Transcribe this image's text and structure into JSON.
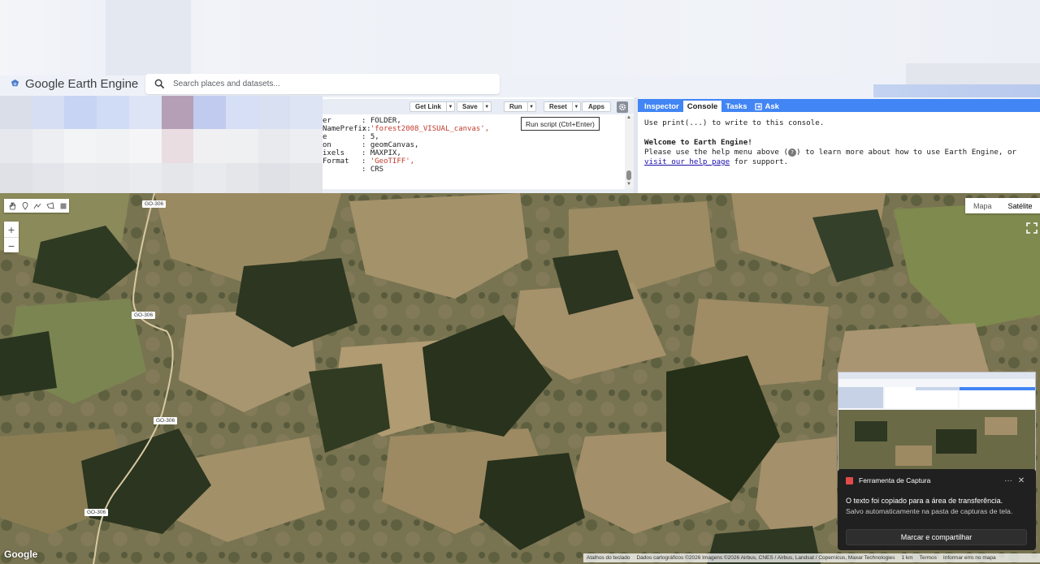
{
  "header": {
    "logo_text": "Google Earth Engine",
    "search_placeholder": "Search places and datasets..."
  },
  "editor": {
    "toolbar": {
      "get_link": "Get Link",
      "save": "Save",
      "run": "Run",
      "reset": "Reset",
      "apps": "Apps"
    },
    "tooltip": "Run script (Ctrl+Enter)",
    "code_lines": [
      {
        "key": "er",
        "value": "FOLDER,",
        "string": false
      },
      {
        "key": "NamePrefix:",
        "value": "'forest2008_VISUAL_canvas',",
        "string": true
      },
      {
        "key": "e",
        "value": "5,",
        "string": false
      },
      {
        "key": "on",
        "value": "geomCanvas,",
        "string": false
      },
      {
        "key": "ixels",
        "value": "MAXPIX,",
        "string": false
      },
      {
        "key": "Format",
        "value": "'GeoTIFF',",
        "string": true
      },
      {
        "key": "",
        "value": "CRS",
        "string": false
      }
    ]
  },
  "console": {
    "tabs": [
      "Inspector",
      "Console",
      "Tasks",
      "Ask"
    ],
    "active_tab": "Console",
    "line1": "Use print(...) to write to this console.",
    "welcome": "Welcome to Earth Engine!",
    "help_pre": "Please use the help menu above (",
    "help_icon": "?",
    "help_mid": ") to learn more about how to use Earth Engine, or ",
    "help_link": "visit our help page",
    "help_post": " for support."
  },
  "map": {
    "map_type_options": [
      "Mapa",
      "Satélite"
    ],
    "selected_map_type": "Satélite",
    "road_labels": [
      "GO-306",
      "GO-306",
      "GO-306",
      "GO-306"
    ],
    "google_logo": "Google",
    "attribution": {
      "keyboard": "Atalhos do teclado",
      "data": "Dados cartográficos ©2026 Imagens ©2026 Airbus, CNES / Airbus, Landsat / Copernicus, Maxar Technologies",
      "scale": "1 km",
      "terms": "Termos",
      "report": "Informar erro no mapa"
    }
  },
  "toast": {
    "app_name": "Ferramenta de Captura",
    "message": "O texto foi copiado para a área de transferência.",
    "submessage": "Salvo automaticamente na pasta de capturas de tela.",
    "button": "Marcar e compartilhar",
    "more": "···",
    "close": "✕"
  },
  "colors": {
    "accent": "#4285f4",
    "code_string": "#c0392b",
    "toast_bg": "#202020"
  }
}
